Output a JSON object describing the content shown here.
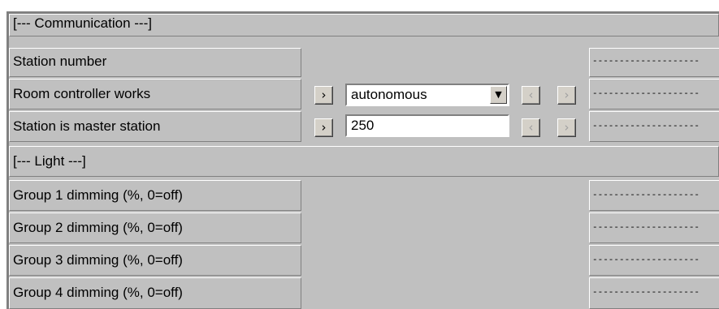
{
  "sections": {
    "communication_header": "[--- Communication ---]",
    "light_header": "[--- Light ---]"
  },
  "rows": {
    "station_number": {
      "label": "Station number",
      "status": "--------------------"
    },
    "room_controller": {
      "label": "Room controller works",
      "value": "autonomous",
      "status": "--------------------"
    },
    "master_station": {
      "label": "Station is master station",
      "value": "250",
      "status": "--------------------"
    },
    "group1": {
      "label": "Group 1 dimming (%, 0=off)",
      "status": "--------------------"
    },
    "group2": {
      "label": "Group 2 dimming (%, 0=off)",
      "status": "--------------------"
    },
    "group3": {
      "label": "Group 3 dimming (%, 0=off)",
      "status": "--------------------"
    },
    "group4": {
      "label": "Group 4 dimming (%, 0=off)",
      "status": "--------------------"
    }
  },
  "icons": {
    "apply": "›",
    "prev": "‹",
    "next": "›",
    "dropdown": "▼"
  }
}
